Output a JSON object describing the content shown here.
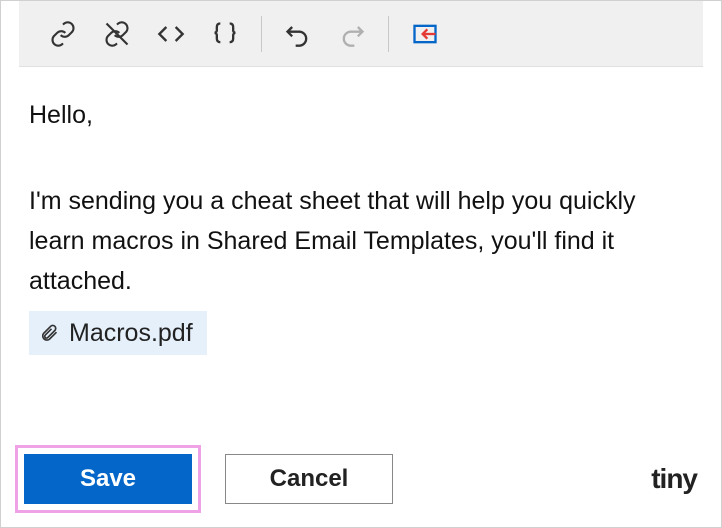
{
  "toolbar": {
    "icons": {
      "link": "link-icon",
      "unlink": "unlink-icon",
      "code": "code-icon",
      "braces": "braces-icon",
      "undo": "undo-icon",
      "redo": "redo-icon",
      "insert": "insert-icon"
    }
  },
  "editor": {
    "greeting": "Hello,",
    "body": "I'm sending you a cheat sheet that will help you quickly learn macros in Shared Email Templates, you'll find it attached.",
    "attachment_name": "Macros.pdf"
  },
  "footer": {
    "save_label": "Save",
    "cancel_label": "Cancel",
    "brand": "tiny"
  }
}
